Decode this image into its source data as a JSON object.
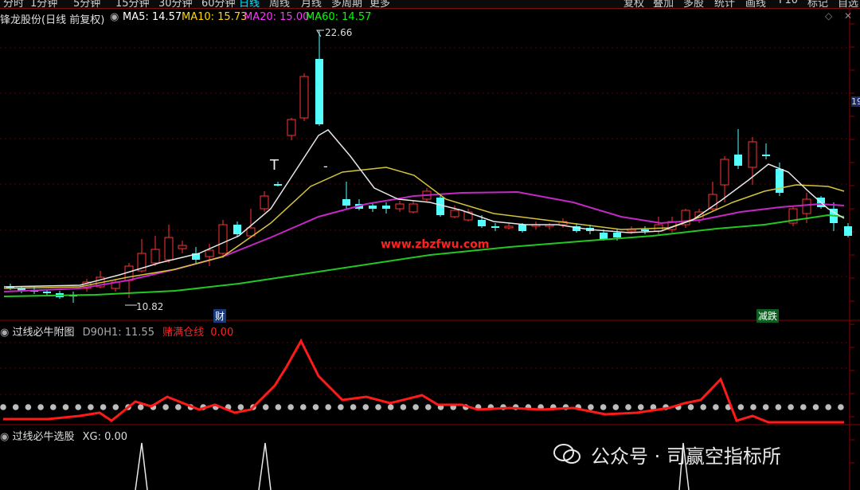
{
  "toolbar": {
    "periods": [
      "分时",
      "1分钟",
      "5分钟",
      "15分钟",
      "30分钟",
      "60分钟",
      "日线",
      "周线",
      "月线",
      "多周期",
      "更多"
    ],
    "active_period": "日线",
    "right_buttons": [
      "复权",
      "叠加",
      "多股",
      "统计",
      "画线",
      "F10",
      "标记"
    ],
    "partial_right": "自选"
  },
  "main_panel": {
    "title": "锋龙股份(日线 前复权)",
    "ma": [
      {
        "label": "MA5: 14.57",
        "color": "#ffffff"
      },
      {
        "label": "MA10: 15.73",
        "color": "#ffd700"
      },
      {
        "label": "MA20: 15.00",
        "color": "#ff33ff"
      },
      {
        "label": "MA60: 14.57",
        "color": "#00ff00"
      }
    ],
    "high_label": "22.66",
    "low_label": "10.82",
    "watermark_url": "www.zbzfwu.com",
    "badge_cai": "财",
    "badge_jiandie": "减跌",
    "edge_label": "19",
    "t_mark": "T",
    "dash_mark": "-"
  },
  "sub1": {
    "title": "过线必牛附图",
    "value1": "D90H1: 11.55",
    "value2_label": "赌满仓线",
    "value2": "0.00"
  },
  "sub2": {
    "title": "过线必牛选股",
    "value": "XG: 0.00"
  },
  "footer_watermark": "公众号 · 司赢空指标所",
  "colors": {
    "up": "#ff3333",
    "down": "#54ffff",
    "ma5": "#e6e6e6",
    "ma10": "#d4c43a",
    "ma20": "#c428c4",
    "ma60": "#22c722",
    "sub_line": "#ff1a1a",
    "grid": "#5a0000"
  }
}
